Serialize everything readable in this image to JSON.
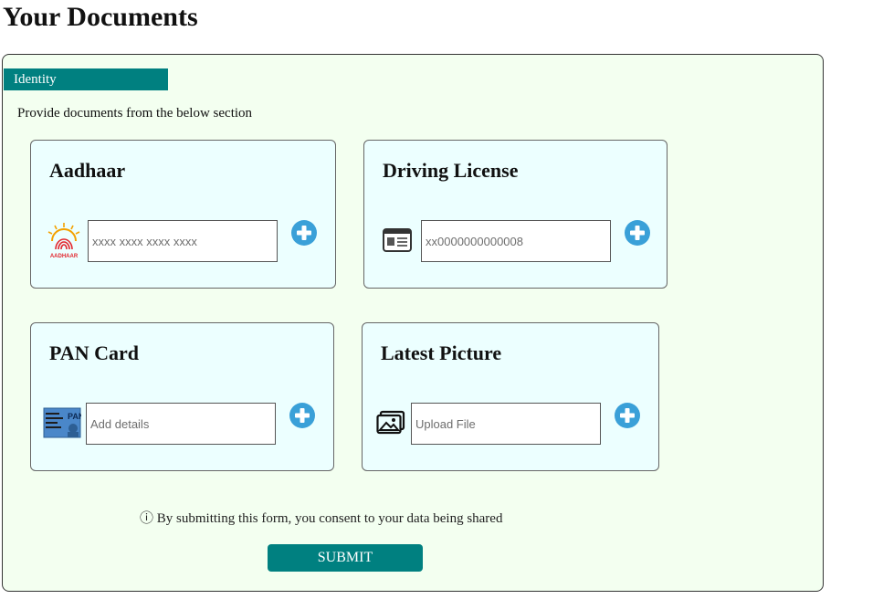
{
  "page": {
    "title": "Your Documents"
  },
  "section": {
    "tab_label": "Identity",
    "instructions": "Provide documents from the below section"
  },
  "cards": [
    {
      "title": "Aadhaar",
      "placeholder": "xxxx xxxx xxxx xxxx",
      "icon": "aadhaar-logo-icon"
    },
    {
      "title": "Driving License",
      "placeholder": "xx0000000000008",
      "icon": "id-card-icon"
    },
    {
      "title": "PAN Card",
      "placeholder": "Add details",
      "icon": "pan-card-icon"
    },
    {
      "title": "Latest Picture",
      "placeholder": "Upload File",
      "icon": "image-icon"
    }
  ],
  "aadhaar_logo_text": "AADHAAR",
  "pan_logo_text": "PAN",
  "consent": {
    "icon": "ⓘ",
    "text": "By submitting this form, you consent to your data being shared"
  },
  "submit": {
    "label": "SUBMIT"
  },
  "colors": {
    "accent": "#008080",
    "panel_bg": "#f3fff0",
    "card_bg": "#ecffff",
    "add_icon": "#3aa0d8"
  }
}
